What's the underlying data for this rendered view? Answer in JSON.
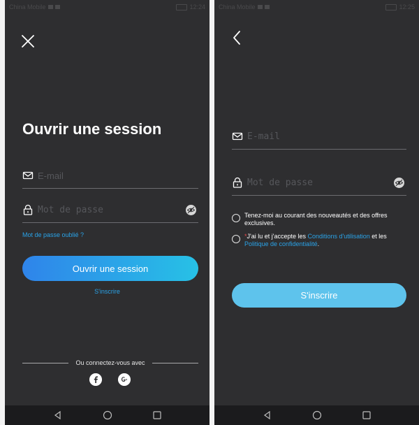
{
  "status_left": {
    "carrier": "China Mobile",
    "time": "12:24"
  },
  "status_right": {
    "carrier": "China Mobile",
    "time": "12:25"
  },
  "login": {
    "title": "Ouvrir une session",
    "email_placeholder": "E-mail",
    "password_placeholder": "Mot de passe",
    "forgot_password": "Mot de passe oublié ?",
    "submit_label": "Ouvrir une session",
    "signup_link": "S'inscrire",
    "social_divider": "Ou connectez-vous avec",
    "social": [
      "facebook-icon",
      "google-plus-icon"
    ]
  },
  "signup": {
    "email_placeholder": "E-mail",
    "password_placeholder": "Mot de passe",
    "newsletter_text": "Tenez-moi au courant des nouveautés et des offres exclusives.",
    "terms_asterisk": "*",
    "terms_pre": "J'ai lu et j'accepte les ",
    "terms_link": "Conditions d'utilisation",
    "terms_mid": " et les ",
    "privacy_link": "Politique de confidentialité",
    "terms_end": ".",
    "submit_label": "S'inscrire"
  },
  "colors": {
    "background": "#2e2e30",
    "accent_link": "#2aa3e8",
    "gradient_start": "#2f84ea",
    "gradient_end": "#27c1e6",
    "signup_button": "#5ec3ec",
    "required_mark": "#e84a4a"
  }
}
